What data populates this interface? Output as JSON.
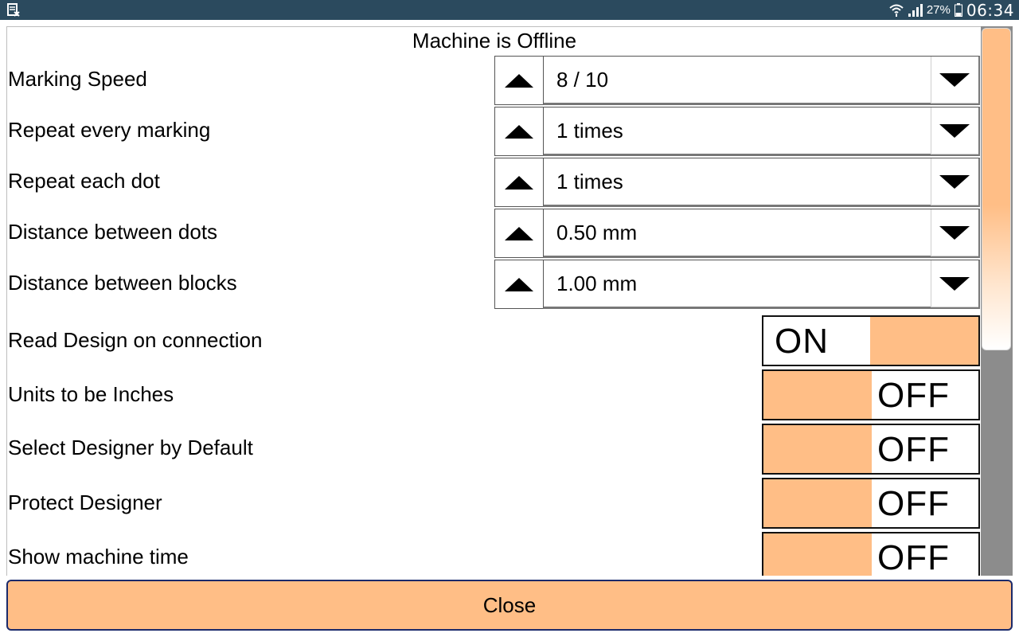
{
  "status_bar": {
    "left_icon": "screenshot-icon",
    "wifi_icon": "wifi-icon",
    "signal_icon": "signal-icon",
    "battery_icon": "battery-icon",
    "battery_percent": "27%",
    "time": "06:34"
  },
  "panel": {
    "status_title": "Machine is Offline",
    "steppers": [
      {
        "label": "Marking Speed",
        "value": "8 / 10"
      },
      {
        "label": "Repeat every marking",
        "value": "1 times"
      },
      {
        "label": "Repeat each dot",
        "value": "1 times"
      },
      {
        "label": "Distance between dots",
        "value": "0.50 mm"
      },
      {
        "label": "Distance between blocks",
        "value": "1.00 mm"
      }
    ],
    "toggles": [
      {
        "label": "Read Design on connection",
        "state": "ON"
      },
      {
        "label": "Units to be Inches",
        "state": "OFF"
      },
      {
        "label": "Select Designer by Default",
        "state": "OFF"
      },
      {
        "label": "Protect Designer",
        "state": "OFF"
      },
      {
        "label": "Show machine time",
        "state": "OFF"
      }
    ]
  },
  "colors": {
    "accent": "#ffbe86",
    "status_bar": "#2b4a5e",
    "scroll_track": "#8c8c8c"
  },
  "footer": {
    "close_label": "Close"
  }
}
